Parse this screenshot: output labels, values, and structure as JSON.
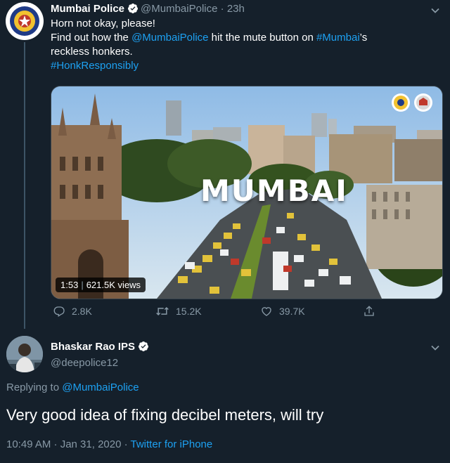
{
  "original_tweet": {
    "display_name": "Mumbai Police",
    "handle": "@MumbaiPolice",
    "separator": "·",
    "time": "23h",
    "line1": "Horn not okay, please!",
    "line2_pre": "Find out how the ",
    "line2_mention": "@MumbaiPolice",
    "line2_mid": " hit the mute button on ",
    "line2_tag": "#Mumbai",
    "line2_post": "’s",
    "line3": "reckless honkers.",
    "hashtag": "#HonkResponsibly",
    "video": {
      "overlay_title": "MUMBAI",
      "duration": "1:53",
      "views": "621.5K views"
    },
    "actions": {
      "replies": "2.8K",
      "retweets": "15.2K",
      "likes": "39.7K"
    }
  },
  "reply_tweet": {
    "display_name": "Bhaskar Rao IPS",
    "handle": "@deepolice12",
    "replying_prefix": "Replying to ",
    "replying_to": "@MumbaiPolice",
    "text": "Very good idea of fixing decibel meters, will try",
    "timestamp": "10:49 AM · Jan 31, 2020",
    "separator": " · ",
    "source": "Twitter for iPhone"
  },
  "colors": {
    "background": "#15202b",
    "accent": "#1da1f2",
    "muted": "#8899a6"
  }
}
